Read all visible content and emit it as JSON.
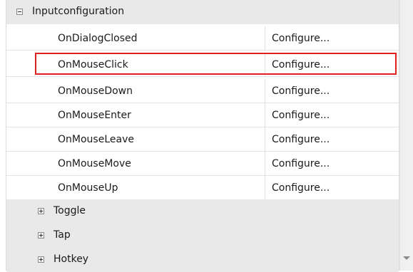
{
  "categories": {
    "input": {
      "label": "Inputconfiguration",
      "expanded": true
    },
    "toggle": {
      "label": "Toggle",
      "expanded": false
    },
    "tap": {
      "label": "Tap",
      "expanded": false
    },
    "hotkey": {
      "label": "Hotkey",
      "expanded": false
    }
  },
  "properties": [
    {
      "name": "OnDialogClosed",
      "value": "Configure..."
    },
    {
      "name": "OnMouseClick",
      "value": "Configure..."
    },
    {
      "name": "OnMouseDown",
      "value": "Configure..."
    },
    {
      "name": "OnMouseEnter",
      "value": "Configure..."
    },
    {
      "name": "OnMouseLeave",
      "value": "Configure..."
    },
    {
      "name": "OnMouseMove",
      "value": "Configure..."
    },
    {
      "name": "OnMouseUp",
      "value": "Configure..."
    }
  ],
  "highlighted_row": "OnMouseClick",
  "colors": {
    "highlight": "#e01f1f",
    "category_bg": "#e9e9e9"
  }
}
